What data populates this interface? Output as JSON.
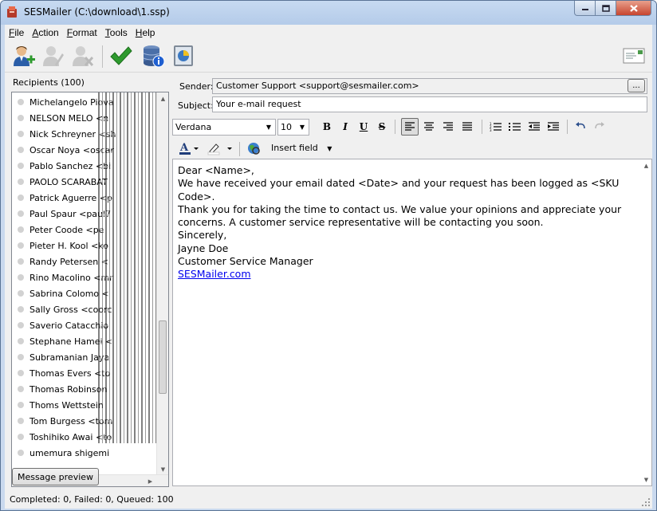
{
  "window": {
    "title": "SESMailer (C:\\download\\1.ssp)"
  },
  "menu": {
    "items": [
      {
        "hotkey": "F",
        "rest": "ile"
      },
      {
        "hotkey": "A",
        "rest": "ction"
      },
      {
        "hotkey": "F",
        "rest": "ormat",
        "ul_index": 0
      },
      {
        "hotkey": "T",
        "rest": "ools"
      },
      {
        "hotkey": "H",
        "rest": "elp"
      }
    ]
  },
  "toolbar": {
    "icons": [
      "add-recipient-icon",
      "edit-recipient-icon",
      "remove-recipient-icon",
      "check-icon",
      "database-info-icon",
      "report-icon",
      "message-envelope-icon"
    ]
  },
  "recipients": {
    "label": "Recipients (100)",
    "items": [
      "Michelangelo Piova",
      "NELSON MELO <n",
      "Nick Schreyner <sh",
      "Oscar Noya <oscar",
      "Pablo Sanchez <bi",
      "PAOLO SCARABAT",
      "Patrick Aguerre <p",
      "Paul Spaur <paul7",
      "Peter Coode <pe",
      "Pieter H. Kool <ko",
      "Randy Petersen <",
      "Rino Macolino <mr",
      "Sabrina Colomo <",
      "Sally Gross <coorc",
      "Saverio Catacchio",
      "Stephane Hamel <",
      "Subramanian Jaya",
      "Thomas Evers <to",
      "Thomas Robinson",
      "Thoms Wettstein",
      "Tom Burgess <tom",
      "Toshihiko Awai <to",
      "umemura shigemi"
    ],
    "preview_button": "Message preview"
  },
  "compose": {
    "sender_label": "Sender:",
    "sender_value": "Customer Support <support@sesmailer.com>",
    "sender_button": "...",
    "subject_label": "Subject:",
    "subject_value": "Your e-mail request",
    "font_name": "Verdana",
    "font_size": "10",
    "insert_field": "Insert field",
    "body": [
      "Dear <Name>,",
      "",
      "We have received your email dated <Date> and your request has been logged as <SKU Code>.",
      "",
      "Thank you for taking the time to contact us. We value your opinions and appreciate your concerns. A customer service representative will be contacting you soon.",
      "",
      "",
      "Sincerely,",
      "Jayne Doe",
      "Customer Service Manager"
    ],
    "body_link": "SESMailer.com"
  },
  "status": {
    "text": "Completed: 0, Failed: 0, Queued: 100"
  },
  "colors": {
    "link": "#0000ee",
    "check": "#2e9a2e",
    "titlebar": "#b9cfec"
  }
}
